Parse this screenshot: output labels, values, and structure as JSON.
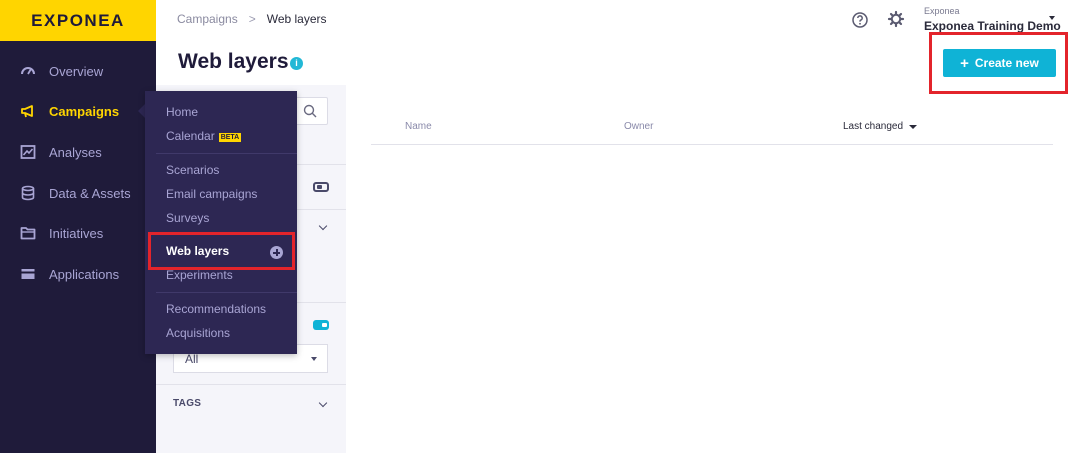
{
  "brand": {
    "logo_text": "EXPONEA",
    "accent": "#ffd500",
    "primary": "#0fb3d6",
    "highlight": "#e3242b"
  },
  "sidebar": {
    "items": [
      {
        "label": "Overview",
        "icon": "gauge-icon"
      },
      {
        "label": "Campaigns",
        "icon": "megaphone-icon",
        "active": true
      },
      {
        "label": "Analyses",
        "icon": "chart-icon"
      },
      {
        "label": "Data & Assets",
        "icon": "database-icon"
      },
      {
        "label": "Initiatives",
        "icon": "folder-icon"
      },
      {
        "label": "Applications",
        "icon": "card-icon"
      }
    ]
  },
  "topbar": {
    "breadcrumb": {
      "parent": "Campaigns",
      "separator": ">",
      "current": "Web layers"
    },
    "help_icon": "help-icon",
    "settings_icon": "gear-icon",
    "project": {
      "org": "Exponea",
      "name": "Exponea Training Demo"
    }
  },
  "header": {
    "title": "Web layers",
    "info_icon": "i",
    "create_button": {
      "plus": "+",
      "label": "Create new"
    }
  },
  "filters": {
    "select_value": "All",
    "tags_label": "TAGS"
  },
  "table": {
    "columns": {
      "name": "Name",
      "owner": "Owner",
      "last_changed": "Last changed"
    }
  },
  "flyout": {
    "home": "Home",
    "calendar": "Calendar",
    "calendar_badge": "BETA",
    "scenarios": "Scenarios",
    "email_campaigns": "Email campaigns",
    "surveys": "Surveys",
    "web_layers": "Web layers",
    "experiments": "Experiments",
    "recommendations": "Recommendations",
    "acquisitions": "Acquisitions"
  }
}
